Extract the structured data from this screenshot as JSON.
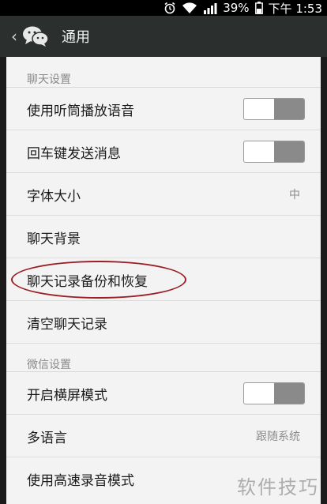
{
  "status_bar": {
    "battery": "39%",
    "time": "下午 1:53"
  },
  "app_bar": {
    "title": "通用"
  },
  "sections": {
    "chat": {
      "header": "聊天设置",
      "items": [
        {
          "label": "使用听筒播放语音"
        },
        {
          "label": "回车键发送消息"
        },
        {
          "label": "字体大小",
          "value": "中"
        },
        {
          "label": "聊天背景"
        },
        {
          "label": "聊天记录备份和恢复"
        },
        {
          "label": "清空聊天记录"
        }
      ]
    },
    "wechat": {
      "header": "微信设置",
      "items": [
        {
          "label": "开启横屏模式"
        },
        {
          "label": "多语言",
          "value": "跟随系统"
        },
        {
          "label": "使用高速录音模式"
        }
      ]
    }
  },
  "watermark": "软件技巧",
  "colors": {
    "highlight_circle": "#9b1f24",
    "app_bar": "#2b2f2d",
    "panel": "#f3f3f3"
  }
}
